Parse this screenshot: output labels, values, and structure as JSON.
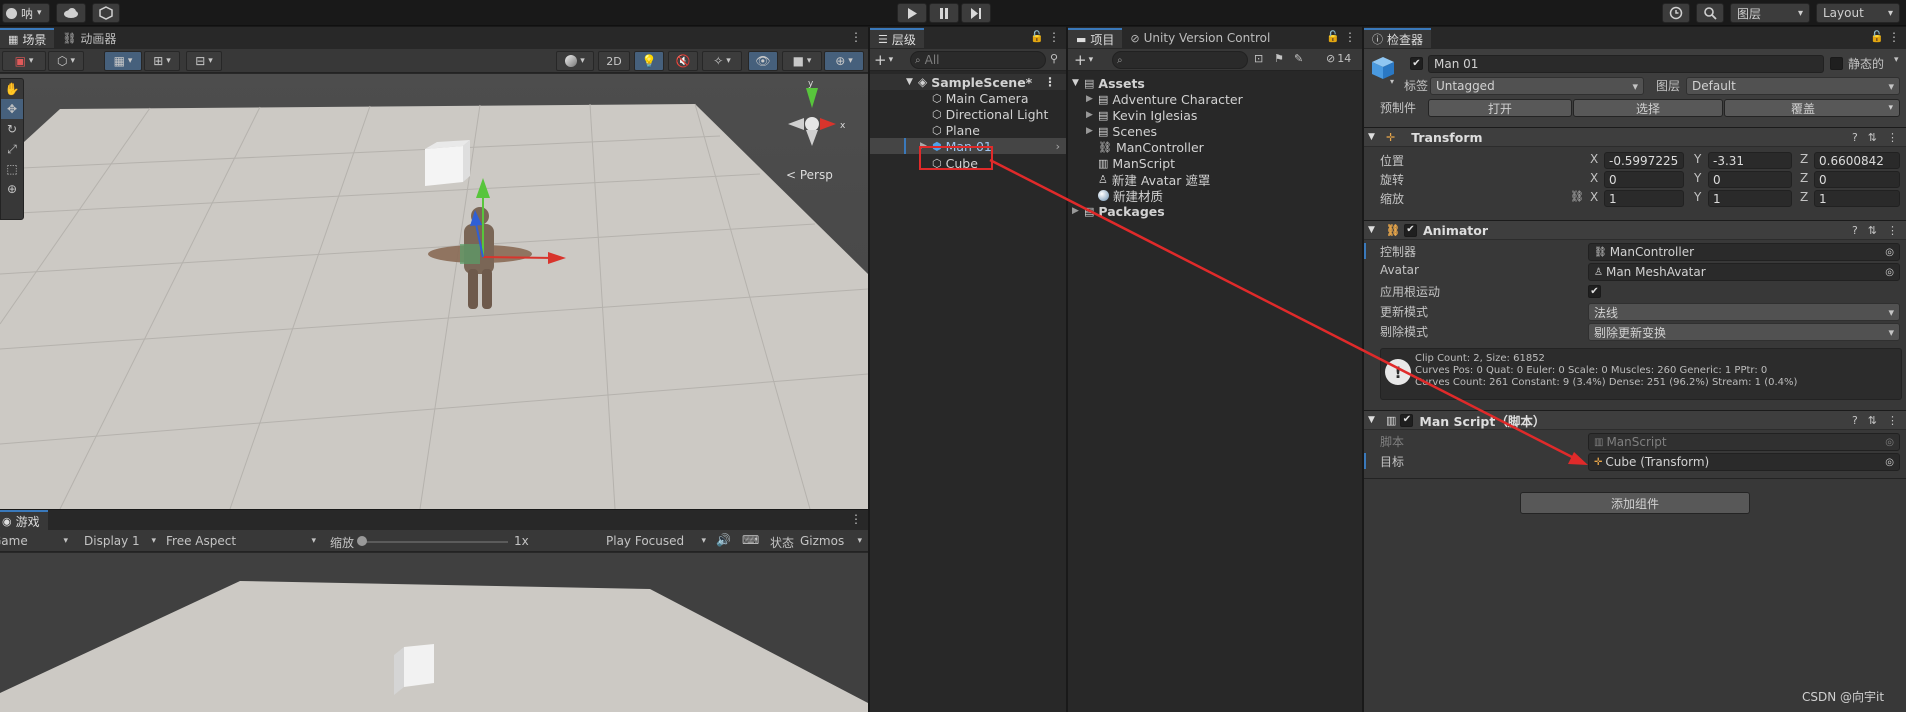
{
  "topbar": {
    "account_label": "呐",
    "layers_label": "图层",
    "layout_label": "Layout"
  },
  "scene_panel": {
    "tabs": [
      "场景",
      "动画器"
    ],
    "toolbar_2d": "2D",
    "persp_label": "< Persp"
  },
  "game_panel": {
    "tab": "游戏",
    "game_label": "Game",
    "display": "Display 1",
    "aspect": "Free Aspect",
    "scale_label": "缩放",
    "scale_value": "1x",
    "play_mode": "Play Focused",
    "stats_label": "状态",
    "gizmos_label": "Gizmos"
  },
  "hierarchy": {
    "tab": "层级",
    "search_placeholder": "All",
    "scene_name": "SampleScene*",
    "items": [
      "Main Camera",
      "Directional Light",
      "Plane",
      "Man 01",
      "Cube"
    ]
  },
  "project": {
    "tabs": [
      "项目",
      "Unity Version Control"
    ],
    "hidden_count": "14",
    "assets_label": "Assets",
    "folders": [
      "Adventure Character",
      "Kevin Iglesias",
      "Scenes"
    ],
    "files": [
      "ManController",
      "ManScript",
      "新建 Avatar 遮罩",
      "新建材质"
    ],
    "packages_label": "Packages"
  },
  "inspector": {
    "tab": "检查器",
    "object_name": "Man 01",
    "static_label": "静态的",
    "tag_label": "标签",
    "tag_value": "Untagged",
    "layer_label": "图层",
    "layer_value": "Default",
    "prefab_label": "预制件",
    "prefab_open": "打开",
    "prefab_select": "选择",
    "prefab_override": "覆盖",
    "transform": {
      "title": "Transform",
      "position_label": "位置",
      "rotation_label": "旋转",
      "scale_label": "缩放",
      "axis_x": "X",
      "axis_y": "Y",
      "axis_z": "Z",
      "position": [
        "-0.5997225",
        "-3.31",
        "0.6600842"
      ],
      "rotation": [
        "0",
        "0",
        "0"
      ],
      "scale": [
        "1",
        "1",
        "1"
      ]
    },
    "animator": {
      "title": "Animator",
      "controller_label": "控制器",
      "controller_value": "ManController",
      "avatar_label": "Avatar",
      "avatar_value": "Man MeshAvatar",
      "root_motion_label": "应用根运动",
      "update_mode_label": "更新模式",
      "update_mode_value": "法线",
      "culling_mode_label": "剔除模式",
      "culling_mode_value": "剔除更新变换",
      "info_line1": "Clip Count: 2, Size: 61852",
      "info_line2": "Curves Pos: 0 Quat: 0 Euler: 0 Scale: 0 Muscles: 260 Generic: 1 PPtr: 0",
      "info_line3": "Curves Count: 261 Constant: 9 (3.4%) Dense: 251 (96.2%) Stream: 1 (0.4%)"
    },
    "script": {
      "title": "Man Script（脚本）",
      "script_label": "脚本",
      "script_value": "ManScript",
      "target_label": "目标",
      "target_value": "Cube (Transform)"
    },
    "add_component": "添加组件"
  },
  "watermark": "CSDN @向宇it",
  "colors": {
    "accent": "#3a79bb",
    "highlight": "#e02a2a",
    "panel": "#383838",
    "viewport": "#ccc9c4"
  }
}
